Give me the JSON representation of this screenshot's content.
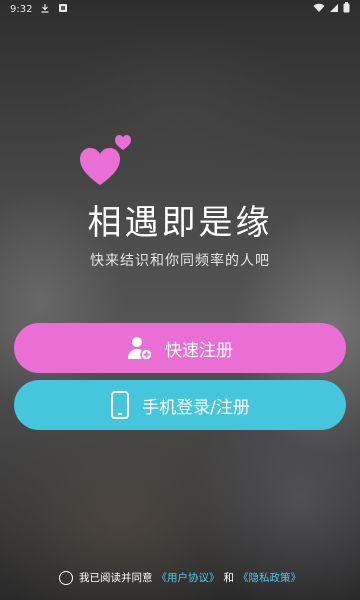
{
  "status_bar": {
    "time": "9:32",
    "icons": [
      "download-icon",
      "app-notification-icon",
      "wifi-icon",
      "signal-icon",
      "battery-icon"
    ]
  },
  "brand": {
    "title": "相遇即是缘",
    "subtitle": "快来结识和你同频率的人吧",
    "logo_icon": "hearts-icon",
    "logo_color": "#e96fd4"
  },
  "buttons": {
    "quick_register": {
      "label": "快速注册",
      "icon": "add-user-icon",
      "color": "#e96fd4"
    },
    "phone_login": {
      "label": "手机登录/注册",
      "icon": "phone-icon",
      "color": "#45c6dd"
    }
  },
  "agreement": {
    "prefix": "我已阅读并同意",
    "user_agreement": "《用户协议》",
    "conjunction": "和",
    "privacy_policy": "《隐私政策》",
    "checked": false,
    "link_color": "#4fc8e8"
  }
}
